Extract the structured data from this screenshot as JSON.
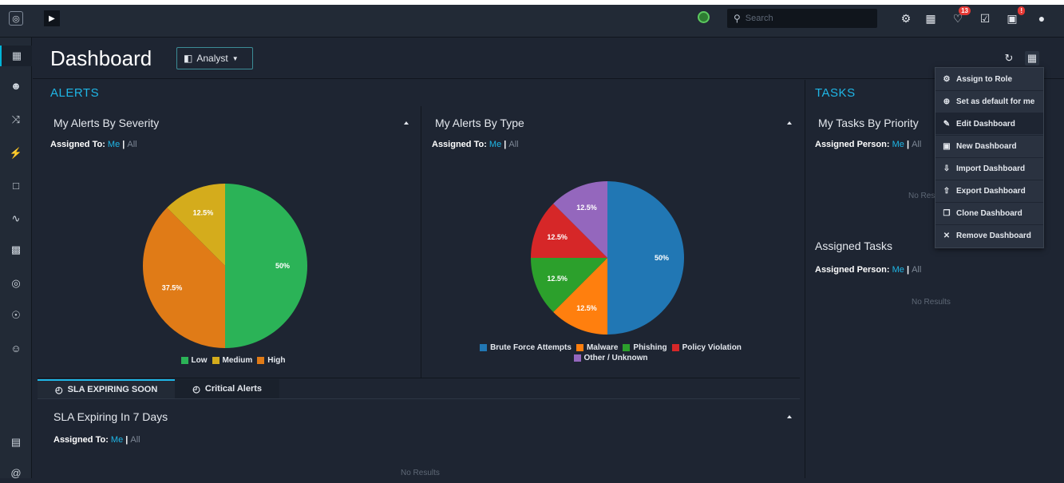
{
  "topbar": {
    "menu_glyph": "▶",
    "logo_glyph": "◎",
    "search_placeholder": "Search",
    "notification_count": "13",
    "task_alert_count": "!",
    "icons": [
      "settings-icon",
      "network-icon",
      "bell-icon",
      "task-check-icon",
      "screen-alert-icon",
      "user-icon"
    ]
  },
  "sidenav": {
    "items": [
      "dashboard-icon",
      "team-icon",
      "shuffle-icon",
      "bolt-icon",
      "briefcase-icon",
      "chart-icon",
      "apps-icon",
      "target-icon",
      "help-icon",
      "people-icon"
    ],
    "bottom_items": [
      "clipboard-icon",
      "at-icon"
    ]
  },
  "header": {
    "title": "Dashboard",
    "view_select": "Analyst",
    "view_glyph": "◧"
  },
  "alerts": {
    "section_title": "ALERTS",
    "severity": {
      "title": "My Alerts By Severity",
      "assigned_label": "Assigned To:",
      "me": "Me",
      "sep": "|",
      "all": "All"
    },
    "type": {
      "title": "My Alerts By Type",
      "assigned_label": "Assigned To:",
      "me": "Me",
      "sep": "|",
      "all": "All"
    }
  },
  "chart_data": [
    {
      "type": "pie",
      "title": "My Alerts By Severity",
      "slices": [
        {
          "label": "Low",
          "value": 50,
          "display": "50%",
          "color": "#2bb357"
        },
        {
          "label": "High",
          "value": 37.5,
          "display": "37.5%",
          "color": "#e07b17"
        },
        {
          "label": "Medium",
          "value": 12.5,
          "display": "12.5%",
          "color": "#d4ac1c"
        }
      ],
      "legend": [
        {
          "label": "Low",
          "color": "#2bb357"
        },
        {
          "label": "Medium",
          "color": "#d4ac1c"
        },
        {
          "label": "High",
          "color": "#e07b17"
        }
      ],
      "legend_position": "bottom"
    },
    {
      "type": "pie",
      "title": "My Alerts By Type",
      "slices": [
        {
          "label": "Brute Force Attempts",
          "value": 50,
          "display": "50%",
          "color": "#2177b4"
        },
        {
          "label": "Malware",
          "value": 12.5,
          "display": "12.5%",
          "color": "#ff7f0e"
        },
        {
          "label": "Phishing",
          "value": 12.5,
          "display": "12.5%",
          "color": "#2ca02c"
        },
        {
          "label": "Policy Violation",
          "value": 12.5,
          "display": "12.5%",
          "color": "#d62728"
        },
        {
          "label": "Other / Unknown",
          "value": 12.5,
          "display": "12.5%",
          "color": "#9467bd"
        }
      ],
      "legend": [
        {
          "label": "Brute Force Attempts",
          "color": "#2177b4"
        },
        {
          "label": "Malware",
          "color": "#ff7f0e"
        },
        {
          "label": "Phishing",
          "color": "#2ca02c"
        },
        {
          "label": "Policy Violation",
          "color": "#d62728"
        },
        {
          "label": "Other / Unknown",
          "color": "#9467bd"
        }
      ],
      "legend_position": "bottom"
    }
  ],
  "sla": {
    "tabs": [
      "SLA EXPIRING SOON",
      "Critical Alerts"
    ],
    "title": "SLA Expiring In 7 Days",
    "assigned_label": "Assigned To:",
    "me": "Me",
    "sep": "|",
    "all": "All",
    "no_results": "No Results"
  },
  "tasks": {
    "section_title": "TASKS",
    "priority_title": "My Tasks By Priority",
    "priority_assigned_label": "Assigned Person:",
    "me": "Me",
    "sep": "|",
    "all": "All",
    "priority_no_results": "No Res",
    "assigned_title": "Assigned Tasks",
    "assigned_assigned_label": "Assigned Person:",
    "assigned_no_results": "No Results"
  },
  "dropdown_menu": {
    "items": [
      {
        "label": "Assign to Role",
        "icon": "role-icon",
        "glyph": "⚙"
      },
      {
        "label": "Set as default for me",
        "icon": "default-icon",
        "glyph": "⊕"
      },
      {
        "label": "Edit Dashboard",
        "icon": "edit-icon",
        "glyph": "✎"
      },
      {
        "label": "New Dashboard",
        "icon": "new-dashboard-icon",
        "glyph": "▣"
      },
      {
        "label": "Import Dashboard",
        "icon": "import-icon",
        "glyph": "⇩"
      },
      {
        "label": "Export Dashboard",
        "icon": "export-icon",
        "glyph": "⇧"
      },
      {
        "label": "Clone Dashboard",
        "icon": "clone-icon",
        "glyph": "❐"
      },
      {
        "label": "Remove Dashboard",
        "icon": "remove-icon",
        "glyph": "✕"
      }
    ],
    "highlighted": "Edit Dashboard"
  },
  "colors": {
    "accent": "#1fb6e6",
    "background": "#1e2532",
    "panel": "#222a36"
  }
}
